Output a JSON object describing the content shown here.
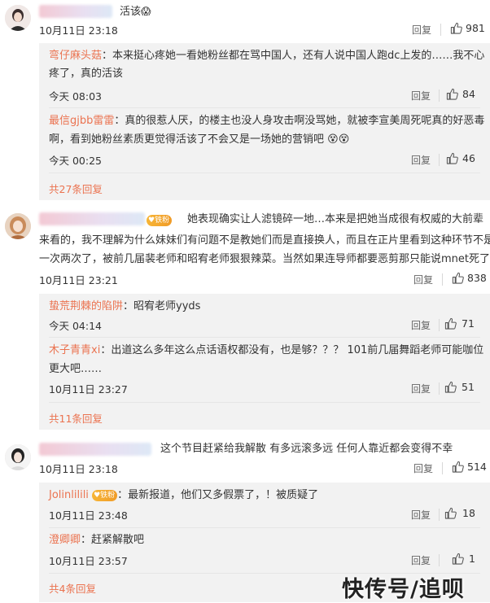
{
  "comments": [
    {
      "text": "活该",
      "time": "10月11日 23:18",
      "reply_label": "回复",
      "likes": "981",
      "replies": [
        {
          "name": "弯仔麻头菇",
          "text1": "本来挺心疼她一看她粉丝都在骂中国人，还有人说中国人跑dc上发的……我不心",
          "text2": "疼了，真的活该",
          "time": "今天 08:03",
          "reply_label": "回复",
          "likes": "84"
        },
        {
          "name": "最信gjbb雷雷",
          "text1": "真的很惹人厌，的楼主也没人身攻击啊没骂她，就被李宣美周死呢真的好恶毒",
          "text2": "啊，看到她粉丝素质更觉得活该了不会又是一场她的营销吧",
          "time": "今天 00:25",
          "reply_label": "回复",
          "likes": "46"
        }
      ],
      "more": "共27条回复"
    },
    {
      "badge": "铁粉",
      "text1": "她表现确实让人滤镜碎一地…本来是把她当成很有权威的大前辈",
      "text2": "来看的，我不理解为什么妹妹们有问题不是教她们而是直接换人，而且在正片里看到这种环节不是",
      "text3": "一次两次了，被前几届裴老师和昭宥老师狠狠辣菜。当然如果连导师都要恶剪那只能说mnet死了",
      "time": "10月11日 23:21",
      "reply_label": "回复",
      "likes": "838",
      "replies": [
        {
          "name": "蛰荒荆棘的陷阱",
          "text1": "昭宥老师yyds",
          "time": "今天 04:14",
          "reply_label": "回复",
          "likes": "71"
        },
        {
          "name": "木子青青xi",
          "text1": "出道这么多年这么点话语权都没有，也是够？？？ 101前几届舞蹈老师可能咖位",
          "text2": "更大吧……",
          "time": "10月11日 23:27",
          "reply_label": "回复",
          "likes": "51"
        }
      ],
      "more": "共11条回复"
    },
    {
      "text": "这个节目赶紧给我解散 有多远滚多远 任何人靠近都会变得不幸",
      "time": "10月11日 23:18",
      "reply_label": "回复",
      "likes": "514",
      "replies": [
        {
          "name": "Jolinlilili",
          "badge": "铁粉",
          "text1": "最新报道，他们又多假票了，！被质疑了",
          "time": "10月11日 23:48",
          "reply_label": "回复",
          "likes": "18"
        },
        {
          "name": "澄卿卿",
          "text1": "赶紧解散吧",
          "time": "10月11日 23:57",
          "reply_label": "回复",
          "likes": "1"
        }
      ],
      "more": "共4条回复"
    }
  ],
  "watermark": "快传号/追呗"
}
